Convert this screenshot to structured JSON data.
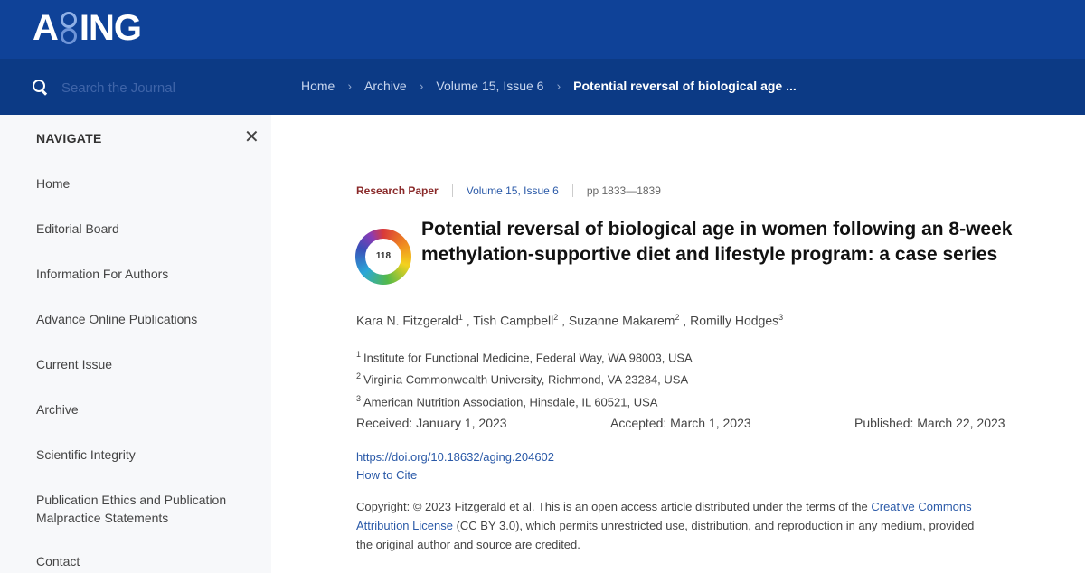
{
  "header": {
    "logo_text": "AGING",
    "brand_color": "#0f4298"
  },
  "search": {
    "placeholder": "Search the Journal",
    "icon": "search-icon"
  },
  "breadcrumb": {
    "items": [
      "Home",
      "Archive",
      "Volume 15, Issue 6"
    ],
    "current": "Potential reversal of biological age ..."
  },
  "sidebar": {
    "title": "NAVIGATE",
    "close_icon": "close-icon",
    "items": [
      {
        "label": "Home"
      },
      {
        "label": "Editorial Board"
      },
      {
        "label": "Information For Authors"
      },
      {
        "label": "Advance Online Publications"
      },
      {
        "label": "Current Issue"
      },
      {
        "label": "Archive"
      },
      {
        "label": "Scientific Integrity"
      },
      {
        "label": "Publication Ethics and Publication Malpractice Statements"
      },
      {
        "label": "Contact"
      }
    ]
  },
  "article": {
    "type": "Research Paper",
    "volume": "Volume 15, Issue 6",
    "pages": "pp 1833—1839",
    "altmetric_score": "118",
    "title": "Potential reversal of biological age in women following an 8-week methylation-supportive diet and lifestyle program: a case series",
    "authors": [
      {
        "name": "Kara N. Fitzgerald",
        "sup": "1"
      },
      {
        "name": "Tish Campbell",
        "sup": "2"
      },
      {
        "name": "Suzanne Makarem",
        "sup": "2"
      },
      {
        "name": "Romilly Hodges",
        "sup": "3"
      }
    ],
    "affiliations": [
      {
        "sup": "1",
        "text": "Institute for Functional Medicine, Federal Way, WA 98003, USA"
      },
      {
        "sup": "2",
        "text": "Virginia Commonwealth University, Richmond, VA 23284, USA"
      },
      {
        "sup": "3",
        "text": "American Nutrition Association, Hinsdale, IL 60521, USA"
      }
    ],
    "received": "Received: January 1, 2023",
    "accepted": "Accepted: March 1, 2023",
    "published": "Published: March 22, 2023",
    "doi": "https://doi.org/10.18632/aging.204602",
    "cite_label": "How to Cite",
    "copyright_line1_pre": "Copyright: © 2023 Fitzgerald et al. This is an open access article distributed under the terms of the ",
    "copyright_link1": "Creative Commons",
    "copyright_link2": "Attribution License",
    "copyright_line2_post": " (CC BY 3.0), which permits unrestricted use, distribution, and reproduction in any medium, provided",
    "copyright_line3": "the original author and source are credited."
  }
}
